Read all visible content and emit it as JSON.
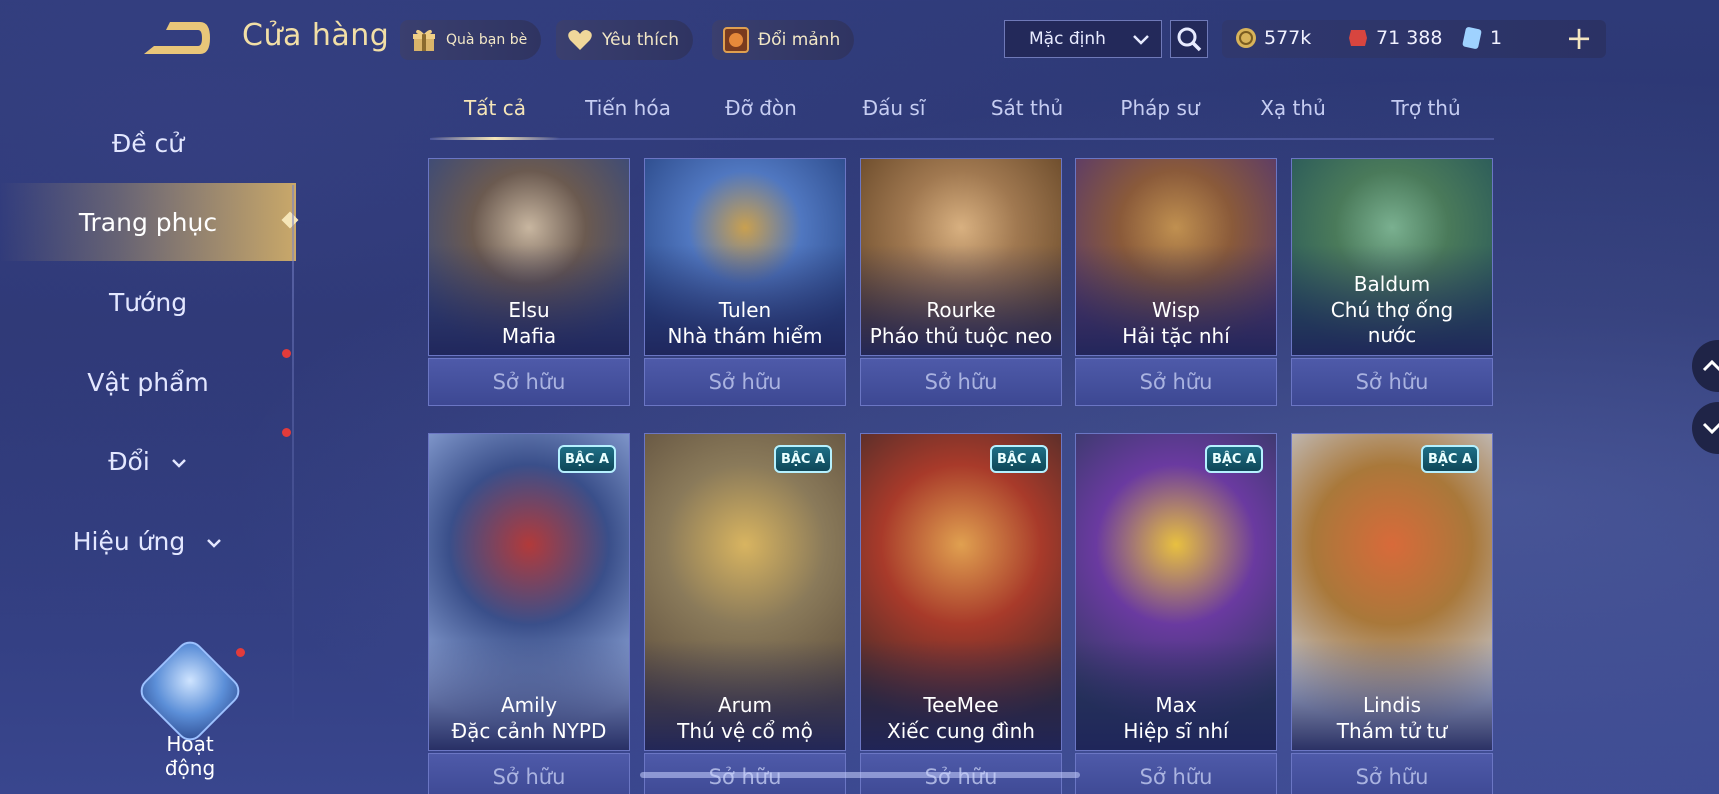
{
  "header": {
    "title": "Cửa hàng",
    "buttons": [
      {
        "label": "Quà bạn bè",
        "icon": "gift-icon"
      },
      {
        "label": "Yêu thích",
        "icon": "heart-icon"
      },
      {
        "label": "Đổi mảnh",
        "icon": "fragment-exchange-icon"
      }
    ],
    "sort": "Mặc định",
    "currency": [
      {
        "value": "577k",
        "icon": "gold-coin-icon"
      },
      {
        "value": "71 388",
        "icon": "voucher-icon"
      },
      {
        "value": "1",
        "icon": "ticket-icon"
      }
    ],
    "add_label": "+"
  },
  "sidebar": {
    "items": [
      {
        "label": "Đề cử",
        "active": false,
        "dot": false,
        "dropdown": false
      },
      {
        "label": "Trang phục",
        "active": true,
        "dot": false,
        "dropdown": false
      },
      {
        "label": "Tướng",
        "active": false,
        "dot": false,
        "dropdown": false
      },
      {
        "label": "Vật phẩm",
        "active": false,
        "dot": true,
        "dropdown": false
      },
      {
        "label": "Đổi",
        "active": false,
        "dot": true,
        "dropdown": true
      },
      {
        "label": "Hiệu ứng",
        "active": false,
        "dot": false,
        "dropdown": true
      }
    ],
    "event_label": "Hoạt động"
  },
  "tabs": [
    "Tất cả",
    "Tiến hóa",
    "Đỡ đòn",
    "Đấu sĩ",
    "Sát thủ",
    "Pháp sư",
    "Xạ thủ",
    "Trợ thủ"
  ],
  "active_tab": 0,
  "cards_row1": [
    {
      "hero": "Elsu",
      "skin": "Mafia",
      "status": "Sở hữu"
    },
    {
      "hero": "Tulen",
      "skin": "Nhà thám hiểm",
      "status": "Sở hữu"
    },
    {
      "hero": "Rourke",
      "skin": "Pháo thủ tuộc neo",
      "status": "Sở hữu"
    },
    {
      "hero": "Wisp",
      "skin": "Hải tặc nhí",
      "status": "Sở hữu"
    },
    {
      "hero": "Baldum",
      "skin": "Chú thợ ống nước",
      "status": "Sở hữu"
    }
  ],
  "cards_row2": [
    {
      "hero": "Amily",
      "skin": "Đặc cảnh NYPD",
      "status": "Sở hữu",
      "badge": "BẬC A"
    },
    {
      "hero": "Arum",
      "skin": "Thú vệ cổ mộ",
      "status": "Sở hữu",
      "badge": "BẬC A"
    },
    {
      "hero": "TeeMee",
      "skin": "Xiếc cung đình",
      "status": "Sở hữu",
      "badge": "BẬC A"
    },
    {
      "hero": "Max",
      "skin": "Hiệp sĩ nhí",
      "status": "Sở hữu",
      "badge": "BẬC A"
    },
    {
      "hero": "Lindis",
      "skin": "Thám tử tư",
      "status": "Sở hữu",
      "badge": "BẬC A"
    }
  ],
  "colors": {
    "accent_gold": "#f2dfa6",
    "card_border": "#6b76c4",
    "badge_bg": "#1e6f86",
    "notify_dot": "#e23b3b"
  }
}
